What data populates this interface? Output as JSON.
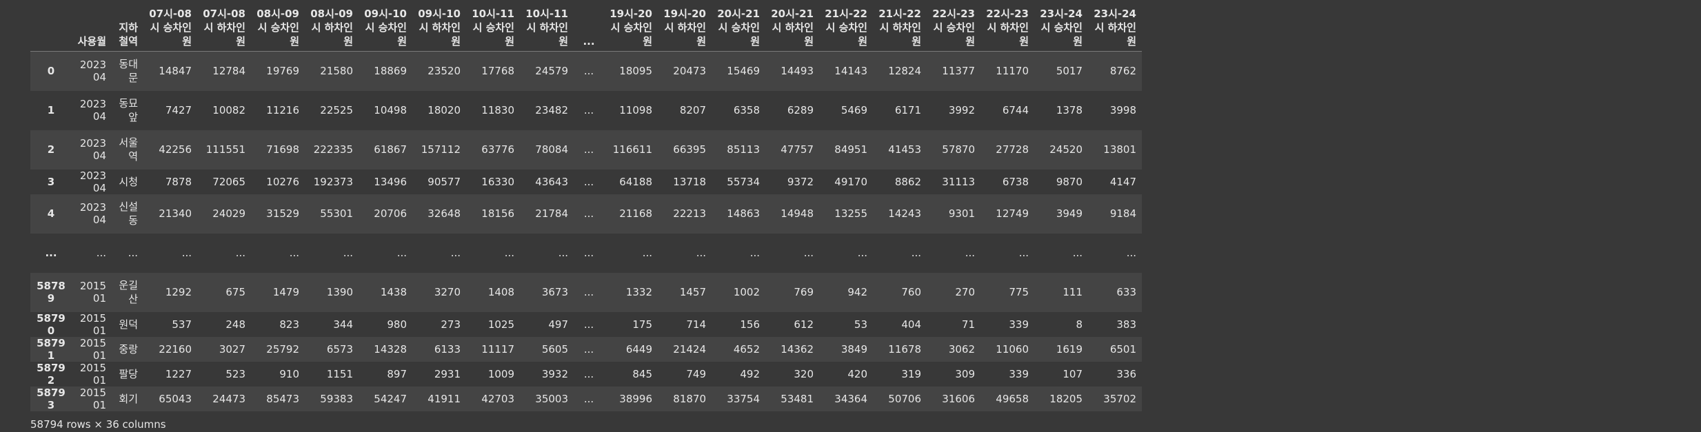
{
  "columns": [
    "",
    "사용월",
    "지하철역",
    "07시-08시 승차인원",
    "07시-08시 하차인원",
    "08시-09시 승차인원",
    "08시-09시 하차인원",
    "09시-10시 승차인원",
    "09시-10시 하차인원",
    "10시-11시 승차인원",
    "10시-11시 하차인원",
    "...",
    "19시-20시 승차인원",
    "19시-20시 하차인원",
    "20시-21시 승차인원",
    "20시-21시 하차인원",
    "21시-22시 승차인원",
    "21시-22시 하차인원",
    "22시-23시 승차인원",
    "22시-23시 하차인원",
    "23시-24시 승차인원",
    "23시-24시 하차인원"
  ],
  "rows": [
    [
      "0",
      "202304",
      "동대문",
      "14847",
      "12784",
      "19769",
      "21580",
      "18869",
      "23520",
      "17768",
      "24579",
      "...",
      "18095",
      "20473",
      "15469",
      "14493",
      "14143",
      "12824",
      "11377",
      "11170",
      "5017",
      "8762"
    ],
    [
      "1",
      "202304",
      "동묘앞",
      "7427",
      "10082",
      "11216",
      "22525",
      "10498",
      "18020",
      "11830",
      "23482",
      "...",
      "11098",
      "8207",
      "6358",
      "6289",
      "5469",
      "6171",
      "3992",
      "6744",
      "1378",
      "3998"
    ],
    [
      "2",
      "202304",
      "서울역",
      "42256",
      "111551",
      "71698",
      "222335",
      "61867",
      "157112",
      "63776",
      "78084",
      "...",
      "116611",
      "66395",
      "85113",
      "47757",
      "84951",
      "41453",
      "57870",
      "27728",
      "24520",
      "13801"
    ],
    [
      "3",
      "202304",
      "시청",
      "7878",
      "72065",
      "10276",
      "192373",
      "13496",
      "90577",
      "16330",
      "43643",
      "...",
      "64188",
      "13718",
      "55734",
      "9372",
      "49170",
      "8862",
      "31113",
      "6738",
      "9870",
      "4147"
    ],
    [
      "4",
      "202304",
      "신설동",
      "21340",
      "24029",
      "31529",
      "55301",
      "20706",
      "32648",
      "18156",
      "21784",
      "...",
      "21168",
      "22213",
      "14863",
      "14948",
      "13255",
      "14243",
      "9301",
      "12749",
      "3949",
      "9184"
    ],
    [
      "...",
      "...",
      "...",
      "...",
      "...",
      "...",
      "...",
      "...",
      "...",
      "...",
      "...",
      "...",
      "...",
      "...",
      "...",
      "...",
      "...",
      "...",
      "...",
      "...",
      "...",
      "..."
    ],
    [
      "58789",
      "201501",
      "운길산",
      "1292",
      "675",
      "1479",
      "1390",
      "1438",
      "3270",
      "1408",
      "3673",
      "...",
      "1332",
      "1457",
      "1002",
      "769",
      "942",
      "760",
      "270",
      "775",
      "111",
      "633"
    ],
    [
      "58790",
      "201501",
      "원덕",
      "537",
      "248",
      "823",
      "344",
      "980",
      "273",
      "1025",
      "497",
      "...",
      "175",
      "714",
      "156",
      "612",
      "53",
      "404",
      "71",
      "339",
      "8",
      "383"
    ],
    [
      "58791",
      "201501",
      "중랑",
      "22160",
      "3027",
      "25792",
      "6573",
      "14328",
      "6133",
      "11117",
      "5605",
      "...",
      "6449",
      "21424",
      "4652",
      "14362",
      "3849",
      "11678",
      "3062",
      "11060",
      "1619",
      "6501"
    ],
    [
      "58792",
      "201501",
      "팔당",
      "1227",
      "523",
      "910",
      "1151",
      "897",
      "2931",
      "1009",
      "3932",
      "...",
      "845",
      "749",
      "492",
      "320",
      "420",
      "319",
      "309",
      "339",
      "107",
      "336"
    ],
    [
      "58793",
      "201501",
      "회기",
      "65043",
      "24473",
      "85473",
      "59383",
      "54247",
      "41911",
      "42703",
      "35003",
      "...",
      "38996",
      "81870",
      "33754",
      "53481",
      "34364",
      "50706",
      "31606",
      "49658",
      "18205",
      "35702"
    ]
  ],
  "footer": "58794 rows × 36 columns"
}
